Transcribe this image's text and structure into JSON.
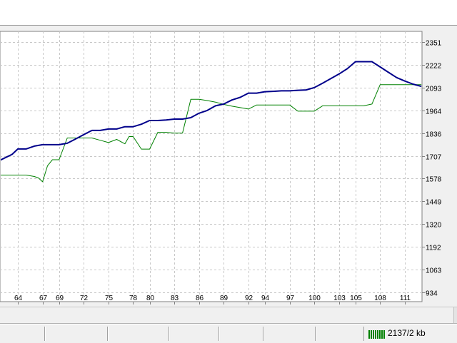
{
  "chart_data": {
    "type": "line",
    "x_ticks": [
      "64",
      "67",
      "69",
      "72",
      "75",
      "78",
      "80",
      "83",
      "86",
      "89",
      "92",
      "94",
      "97",
      "100",
      "103",
      "105",
      "108",
      "111"
    ],
    "y_ticks": [
      "2351",
      "2222",
      "2093",
      "1964",
      "1836",
      "1707",
      "1578",
      "1449",
      "1320",
      "1192",
      "1063",
      "934"
    ],
    "ylim": [
      934,
      2351
    ],
    "xlim": [
      61,
      113.5
    ],
    "grid": true,
    "series": [
      {
        "color": "#00008b",
        "x": [
          61,
          62.2,
          63.3,
          64,
          65,
          66,
          67,
          68,
          69,
          70,
          71,
          72,
          73,
          74,
          75,
          76,
          77,
          78,
          79,
          80,
          81,
          82,
          83,
          84,
          85,
          86,
          87,
          88,
          89,
          90,
          91,
          92,
          93,
          94,
          95,
          96,
          97,
          98,
          99,
          100,
          101,
          102,
          103,
          104,
          105,
          106,
          107,
          108,
          109,
          110,
          111,
          112,
          113
        ],
        "y": [
          1664,
          1690,
          1715,
          1746,
          1746,
          1762,
          1770,
          1770,
          1770,
          1778,
          1802,
          1827,
          1851,
          1851,
          1859,
          1859,
          1872,
          1872,
          1886,
          1907,
          1907,
          1910,
          1915,
          1915,
          1923,
          1948,
          1964,
          1990,
          2000,
          2023,
          2038,
          2062,
          2062,
          2070,
          2072,
          2075,
          2075,
          2078,
          2080,
          2093,
          2118,
          2144,
          2170,
          2200,
          2240,
          2240,
          2240,
          2210,
          2180,
          2150,
          2130,
          2113,
          2100
        ]
      },
      {
        "color": "#008000",
        "x": [
          61,
          62,
          63,
          64,
          65,
          66,
          66.5,
          67,
          67.6,
          68.2,
          69,
          70,
          71,
          72,
          73,
          74,
          75,
          76,
          77,
          77.5,
          78,
          79,
          80,
          81,
          82,
          83,
          84,
          85,
          86,
          87,
          88,
          89,
          90,
          91,
          92,
          93,
          94,
          95,
          96,
          97,
          98,
          99,
          100,
          101,
          102,
          103,
          104,
          105,
          106,
          107,
          108,
          109,
          110,
          111,
          112,
          113
        ],
        "y": [
          1598,
          1598,
          1598,
          1598,
          1598,
          1590,
          1582,
          1560,
          1650,
          1685,
          1685,
          1808,
          1808,
          1808,
          1808,
          1795,
          1782,
          1800,
          1775,
          1816,
          1816,
          1745,
          1745,
          1840,
          1840,
          1836,
          1836,
          2027,
          2027,
          2020,
          2011,
          1998,
          1988,
          1980,
          1972,
          1995,
          1995,
          1995,
          1995,
          1995,
          1960,
          1960,
          1960,
          1990,
          1990,
          1990,
          1990,
          1990,
          1990,
          2000,
          2110,
          2110,
          2110,
          2110,
          2110,
          2110
        ]
      }
    ]
  },
  "status_bar": {
    "connection_icon": "signal-bars-icon",
    "connection_text": "2137/2 kb"
  }
}
